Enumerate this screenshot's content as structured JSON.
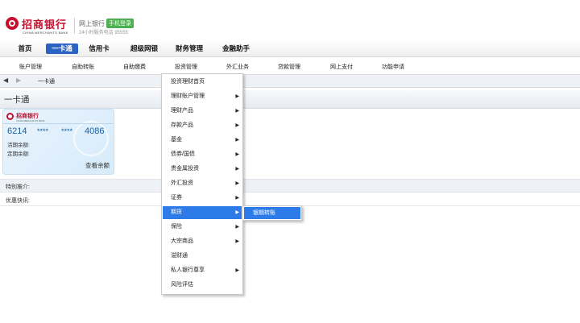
{
  "header": {
    "bank_name": "招商银行",
    "bank_name_en": "CHINA MERCHANTS BANK",
    "online_title": "网上银行",
    "login_badge": "手机登录",
    "hotline": "24小时服务电话 95555"
  },
  "main_nav": [
    "首页",
    "一卡通",
    "信用卡",
    "超级网银",
    "财务管理",
    "金融助手"
  ],
  "main_nav_active": "一卡通",
  "sub_nav": [
    "账户管理",
    "自助转账",
    "自助缴费",
    "投资管理",
    "外汇业务",
    "贷款管理",
    "网上支付",
    "功能申请"
  ],
  "breadcrumb": {
    "back": "◀",
    "forward": "▶",
    "current": "一卡通"
  },
  "page_title": "一卡通",
  "card": {
    "bank_name": "招商银行",
    "bank_name_en": "CHINA MERCHANTS BANK",
    "number_parts": [
      "6214",
      "****",
      "****",
      "4086"
    ],
    "current_balance_label": "活期余额:",
    "fixed_balance_label": "定期余额:",
    "query_label": "查看余额"
  },
  "special_offer_label": "特别推介:",
  "promo_label": "优惠快讯:",
  "investment_menu": {
    "items": [
      {
        "label": "投资理财首页",
        "has_submenu": false
      },
      {
        "label": "理财账户管理",
        "has_submenu": true
      },
      {
        "label": "理财产品",
        "has_submenu": true
      },
      {
        "label": "存款产品",
        "has_submenu": true
      },
      {
        "label": "基金",
        "has_submenu": true
      },
      {
        "label": "债券/国债",
        "has_submenu": true
      },
      {
        "label": "贵金属投资",
        "has_submenu": true
      },
      {
        "label": "外汇投资",
        "has_submenu": true
      },
      {
        "label": "证券",
        "has_submenu": true
      },
      {
        "label": "期货",
        "has_submenu": true,
        "highlighted": true
      },
      {
        "label": "保险",
        "has_submenu": true
      },
      {
        "label": "大宗商品",
        "has_submenu": true
      },
      {
        "label": "溢财通",
        "has_submenu": false
      },
      {
        "label": "私人银行尊享",
        "has_submenu": true
      },
      {
        "label": "风险评估",
        "has_submenu": false
      }
    ],
    "submenu_arrow": "▶",
    "futures_submenu": [
      "银期转账"
    ]
  },
  "colors": {
    "brand_red": "#c8102e",
    "nav_active": "#2b63c4",
    "menu_highlight": "#2d7be8"
  }
}
